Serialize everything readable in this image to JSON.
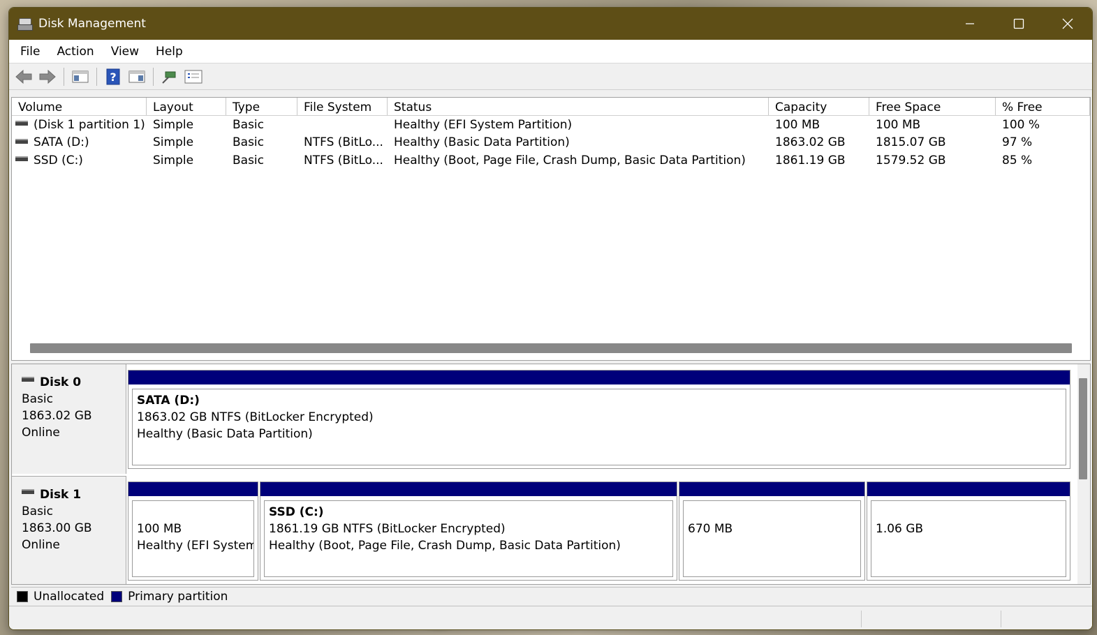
{
  "window": {
    "title": "Disk Management"
  },
  "menu": [
    "File",
    "Action",
    "View",
    "Help"
  ],
  "toolbar": {
    "icons": [
      "back-arrow-icon",
      "forward-arrow-icon",
      "console-tree-icon",
      "help-icon",
      "properties-panel-icon",
      "disk-tool-icon",
      "checklist-icon"
    ]
  },
  "volumes": {
    "columns": [
      "Volume",
      "Layout",
      "Type",
      "File System",
      "Status",
      "Capacity",
      "Free Space",
      "% Free"
    ],
    "rows": [
      [
        "(Disk 1 partition 1)",
        "Simple",
        "Basic",
        "",
        "Healthy (EFI System Partition)",
        "100 MB",
        "100 MB",
        "100 %"
      ],
      [
        "SATA (D:)",
        "Simple",
        "Basic",
        "NTFS (BitLo...",
        "Healthy (Basic Data Partition)",
        "1863.02 GB",
        "1815.07 GB",
        "97 %"
      ],
      [
        "SSD (C:)",
        "Simple",
        "Basic",
        "NTFS (BitLo...",
        "Healthy (Boot, Page File, Crash Dump, Basic Data Partition)",
        "1861.19 GB",
        "1579.52 GB",
        "85 %"
      ]
    ]
  },
  "disks": [
    {
      "name": "Disk 0",
      "type": "Basic",
      "size": "1863.02 GB",
      "state": "Online",
      "partitions": [
        {
          "name": "SATA  (D:)",
          "line1": "1863.02 GB NTFS (BitLocker Encrypted)",
          "line2": "Healthy (Basic Data Partition)"
        }
      ]
    },
    {
      "name": "Disk 1",
      "type": "Basic",
      "size": "1863.00 GB",
      "state": "Online",
      "partitions": [
        {
          "name": "",
          "line1": "100 MB",
          "line2": "Healthy (EFI System P"
        },
        {
          "name": "SSD  (C:)",
          "line1": "1861.19 GB NTFS (BitLocker Encrypted)",
          "line2": "Healthy (Boot, Page File, Crash Dump, Basic Data Partition)"
        },
        {
          "name": "",
          "line1": "670 MB",
          "line2": ""
        },
        {
          "name": "",
          "line1": "1.06 GB",
          "line2": ""
        }
      ]
    }
  ],
  "legend": [
    {
      "label": "Unallocated",
      "color": "#000000"
    },
    {
      "label": "Primary partition",
      "color": "#00007a"
    }
  ]
}
